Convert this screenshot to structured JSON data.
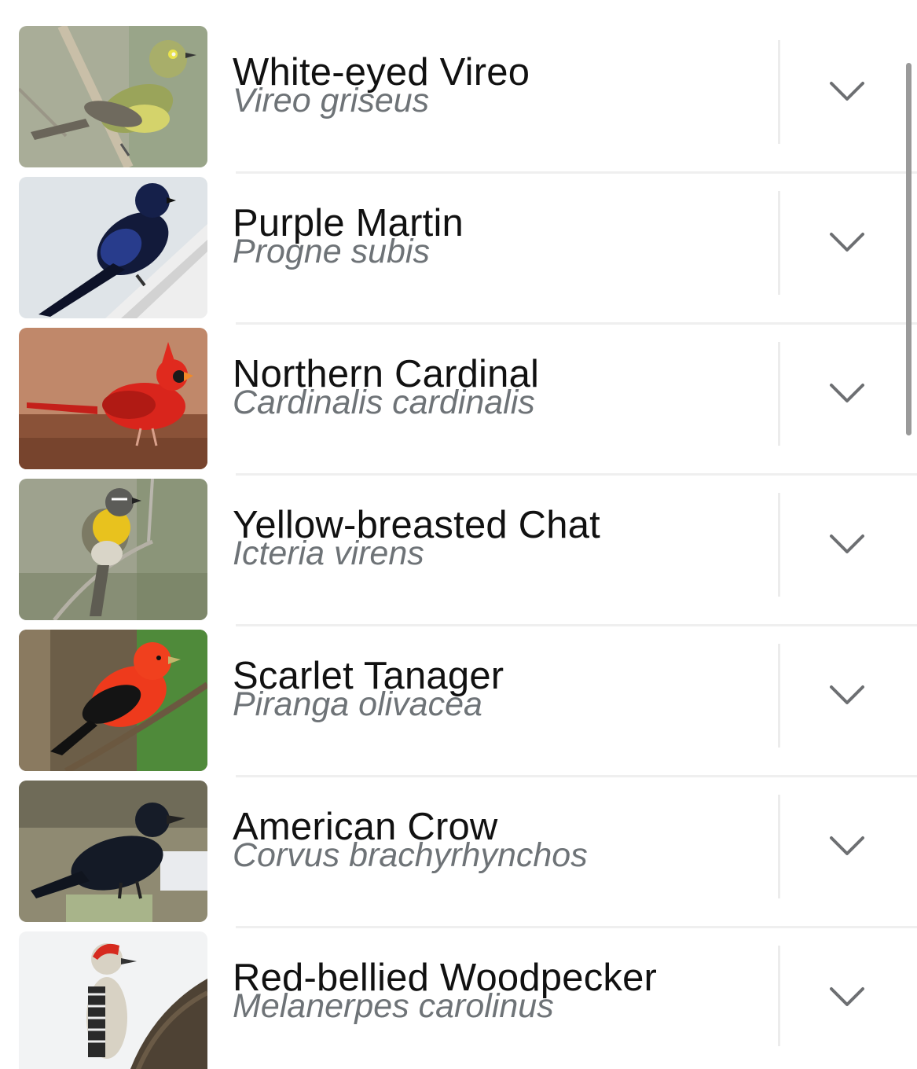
{
  "birds": [
    {
      "common_name": "White-eyed Vireo",
      "scientific_name": "Vireo griseus"
    },
    {
      "common_name": "Purple Martin",
      "scientific_name": "Progne subis"
    },
    {
      "common_name": "Northern Cardinal",
      "scientific_name": "Cardinalis cardinalis"
    },
    {
      "common_name": "Yellow-breasted Chat",
      "scientific_name": "Icteria virens"
    },
    {
      "common_name": "Scarlet Tanager",
      "scientific_name": "Piranga olivacea"
    },
    {
      "common_name": "American Crow",
      "scientific_name": "Corvus brachyrhynchos"
    },
    {
      "common_name": "Red-bellied Woodpecker",
      "scientific_name": "Melanerpes carolinus"
    }
  ],
  "icons": {
    "expand": "chevron-down-icon"
  },
  "colors": {
    "title": "#111111",
    "subtitle": "#6e7377",
    "divider": "#ececec",
    "chevron": "#6d6f72"
  }
}
